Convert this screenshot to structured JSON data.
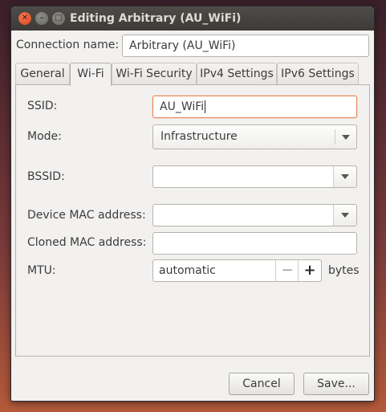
{
  "window": {
    "title": "Editing Arbitrary (AU_WiFi)"
  },
  "connection": {
    "label": "Connection name:",
    "value": "Arbitrary (AU_WiFi)"
  },
  "tabs": [
    {
      "label": "General"
    },
    {
      "label": "Wi-Fi"
    },
    {
      "label": "Wi-Fi Security"
    },
    {
      "label": "IPv4 Settings"
    },
    {
      "label": "IPv6 Settings"
    }
  ],
  "active_tab": "Wi-Fi",
  "wifi": {
    "ssid_label": "SSID:",
    "ssid_value": "AU_WiFi",
    "mode_label": "Mode:",
    "mode_value": "Infrastructure",
    "bssid_label": "BSSID:",
    "bssid_value": "",
    "device_mac_label": "Device MAC address:",
    "device_mac_value": "",
    "cloned_mac_label": "Cloned MAC address:",
    "cloned_mac_value": "",
    "mtu_label": "MTU:",
    "mtu_value": "automatic",
    "mtu_minus": "−",
    "mtu_plus": "+",
    "mtu_unit": "bytes"
  },
  "buttons": {
    "cancel": "Cancel",
    "save": "Save..."
  },
  "colors": {
    "focus_accent": "#e98a5c",
    "close_button": "#e5532a",
    "titlebar": "#3c3b37"
  }
}
